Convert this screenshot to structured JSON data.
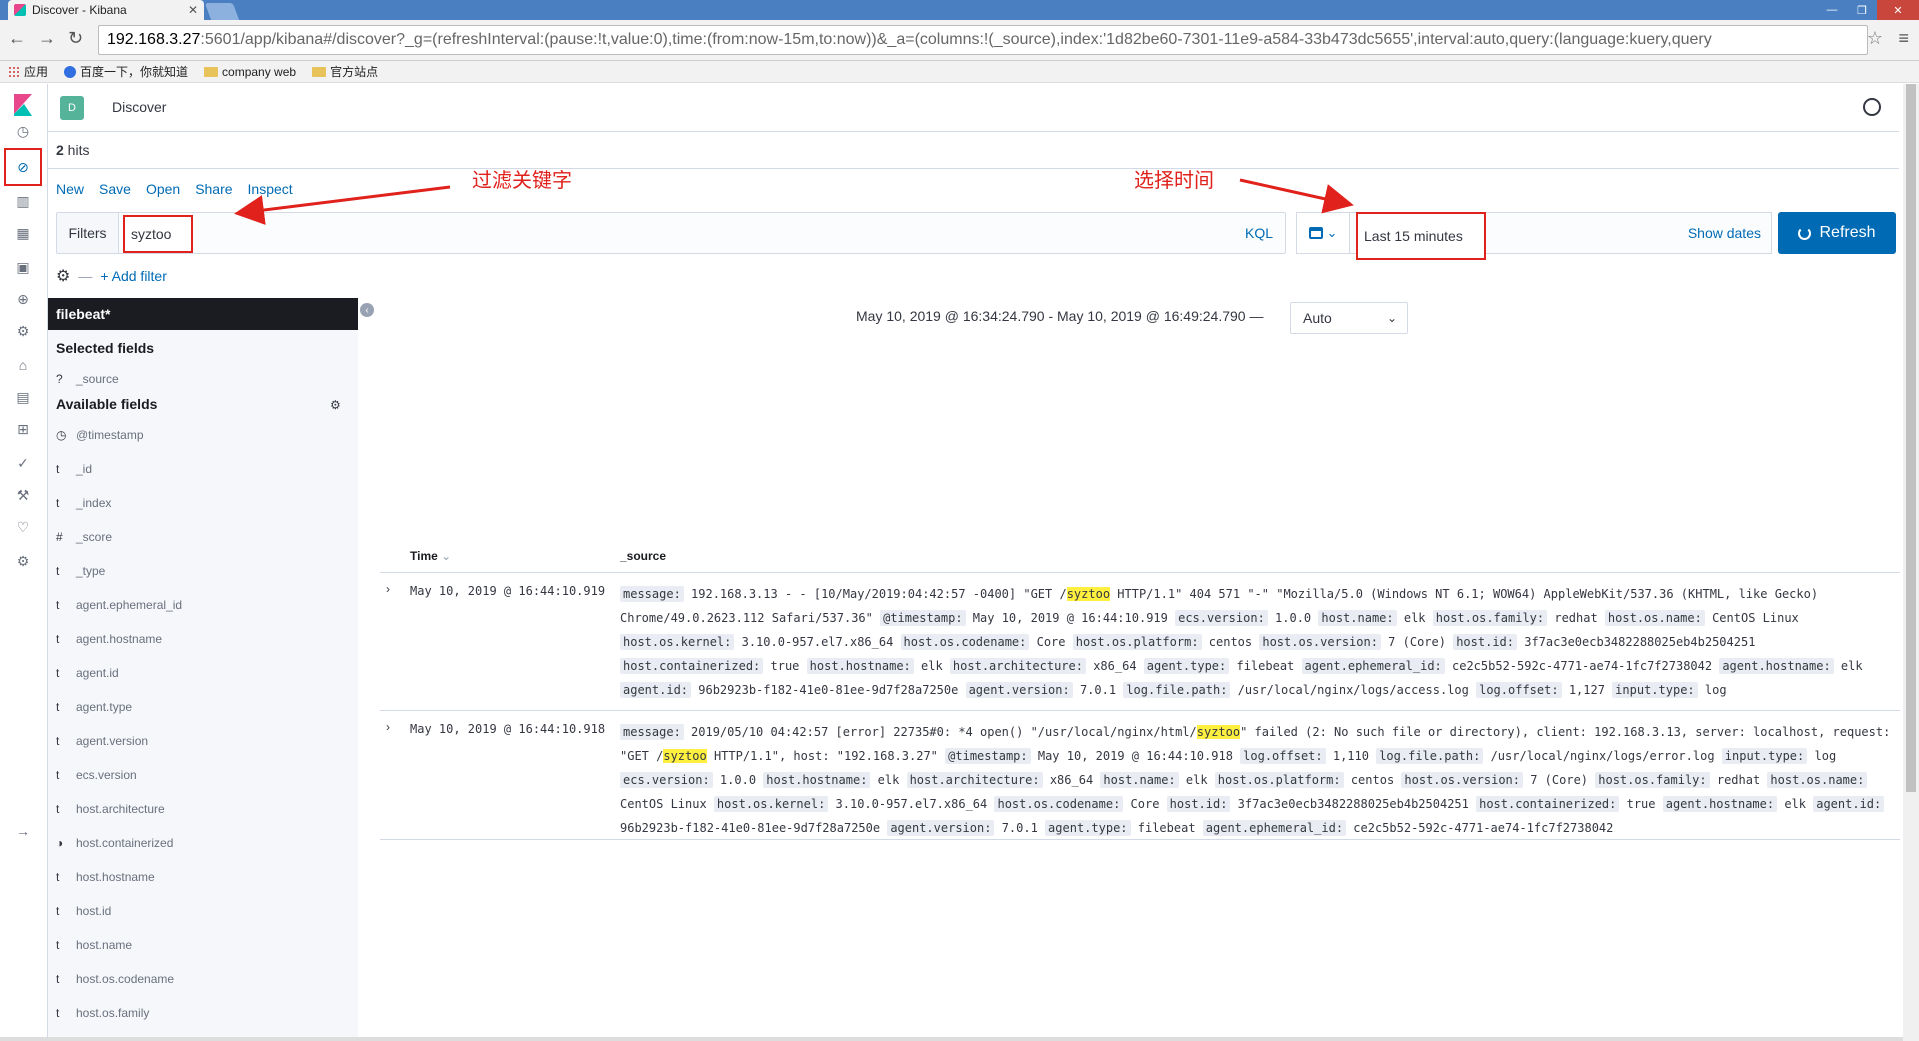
{
  "browser": {
    "tab_title": "Discover - Kibana",
    "url_host": "192.168.3.27",
    "url_rest": ":5601/app/kibana#/discover?_g=(refreshInterval:(pause:!t,value:0),time:(from:now-15m,to:now))&_a=(columns:!(_source),index:'1d82be60-7301-11e9-a584-33b473dc5655',interval:auto,query:(language:kuery,query",
    "bookmarks": [
      "应用",
      "百度一下，你就知道",
      "company web",
      "官方站点"
    ]
  },
  "header": {
    "space_initial": "D",
    "breadcrumb": "Discover"
  },
  "hits": {
    "count": "2",
    "label": " hits"
  },
  "topmenu": [
    "New",
    "Save",
    "Open",
    "Share",
    "Inspect"
  ],
  "query": {
    "filters_label": "Filters",
    "value": "syztoo",
    "language": "KQL"
  },
  "time": {
    "label": "Last 15 minutes",
    "show_dates": "Show dates",
    "refresh": "Refresh"
  },
  "add_filter": "+ Add filter",
  "index_pattern": "filebeat*",
  "selected_fields_title": "Selected fields",
  "selected_fields": [
    {
      "type": "?",
      "name": "_source"
    }
  ],
  "available_fields_title": "Available fields",
  "available_fields": [
    {
      "type": "◷",
      "name": "@timestamp"
    },
    {
      "type": "t",
      "name": "_id"
    },
    {
      "type": "t",
      "name": "_index"
    },
    {
      "type": "#",
      "name": "_score"
    },
    {
      "type": "t",
      "name": "_type"
    },
    {
      "type": "t",
      "name": "agent.ephemeral_id"
    },
    {
      "type": "t",
      "name": "agent.hostname"
    },
    {
      "type": "t",
      "name": "agent.id"
    },
    {
      "type": "t",
      "name": "agent.type"
    },
    {
      "type": "t",
      "name": "agent.version"
    },
    {
      "type": "t",
      "name": "ecs.version"
    },
    {
      "type": "t",
      "name": "host.architecture"
    },
    {
      "type": "◑",
      "name": "host.containerized"
    },
    {
      "type": "t",
      "name": "host.hostname"
    },
    {
      "type": "t",
      "name": "host.id"
    },
    {
      "type": "t",
      "name": "host.name"
    },
    {
      "type": "t",
      "name": "host.os.codename"
    },
    {
      "type": "t",
      "name": "host.os.family"
    }
  ],
  "range_text": "May 10, 2019 @ 16:34:24.790 - May 10, 2019 @ 16:49:24.790 —",
  "interval": "Auto",
  "table": {
    "col_time": "Time",
    "col_source": "_source"
  },
  "rows": [
    {
      "time": "May 10, 2019 @ 16:44:10.919",
      "source_html": "<span class='k'>message:</span> 192.168.3.13 - - [10/May/2019:04:42:57 -0400] \"GET /<span class='hl'>syztoo</span> HTTP/1.1\" 404 571 \"-\" \"Mozilla/5.0 (Windows NT 6.1; WOW64) AppleWebKit/537.36 (KHTML, like Gecko) Chrome/49.0.2623.112 Safari/537.36\" <span class='k'>@timestamp:</span> May 10, 2019 @ 16:44:10.919 <span class='k'>ecs.version:</span> 1.0.0 <span class='k'>host.name:</span> elk <span class='k'>host.os.family:</span> redhat <span class='k'>host.os.name:</span> CentOS Linux <span class='k'>host.os.kernel:</span> 3.10.0-957.el7.x86_64 <span class='k'>host.os.codename:</span> Core <span class='k'>host.os.platform:</span> centos <span class='k'>host.os.version:</span> 7 (Core) <span class='k'>host.id:</span> 3f7ac3e0ecb3482288025eb4b2504251 <span class='k'>host.containerized:</span> true <span class='k'>host.hostname:</span> elk <span class='k'>host.architecture:</span> x86_64 <span class='k'>agent.type:</span> filebeat <span class='k'>agent.ephemeral_id:</span> ce2c5b52-592c-4771-ae74-1fc7f2738042 <span class='k'>agent.hostname:</span> elk <span class='k'>agent.id:</span> 96b2923b-f182-41e0-81ee-9d7f28a7250e <span class='k'>agent.version:</span> 7.0.1 <span class='k'>log.file.path:</span> /usr/local/nginx/logs/access.log <span class='k'>log.offset:</span> 1,127 <span class='k'>input.type:</span> log"
    },
    {
      "time": "May 10, 2019 @ 16:44:10.918",
      "source_html": "<span class='k'>message:</span> 2019/05/10 04:42:57 [error] 22735#0: *4 open() \"/usr/local/nginx/html/<span class='hl'>syztoo</span>\" failed (2: No such file or directory), client: 192.168.3.13, server: localhost, request: \"GET /<span class='hl'>syztoo</span> HTTP/1.1\", host: \"192.168.3.27\" <span class='k'>@timestamp:</span> May 10, 2019 @ 16:44:10.918 <span class='k'>log.offset:</span> 1,110 <span class='k'>log.file.path:</span> /usr/local/nginx/logs/error.log <span class='k'>input.type:</span> log <span class='k'>ecs.version:</span> 1.0.0 <span class='k'>host.hostname:</span> elk <span class='k'>host.architecture:</span> x86_64 <span class='k'>host.name:</span> elk <span class='k'>host.os.platform:</span> centos <span class='k'>host.os.version:</span> 7 (Core) <span class='k'>host.os.family:</span> redhat <span class='k'>host.os.name:</span> CentOS Linux <span class='k'>host.os.kernel:</span> 3.10.0-957.el7.x86_64 <span class='k'>host.os.codename:</span> Core <span class='k'>host.id:</span> 3f7ac3e0ecb3482288025eb4b2504251 <span class='k'>host.containerized:</span> true <span class='k'>agent.hostname:</span> elk <span class='k'>agent.id:</span> 96b2923b-f182-41e0-81ee-9d7f28a7250e <span class='k'>agent.version:</span> 7.0.1 <span class='k'>agent.type:</span> filebeat <span class='k'>agent.ephemeral_id:</span> ce2c5b52-592c-4771-ae74-1fc7f2738042"
    }
  ],
  "annotations": {
    "filter": "过滤关键字",
    "time": "选择时间"
  },
  "colors": {
    "accent": "#006bb4",
    "annotation": "#e0211c",
    "highlight": "#fff03f"
  }
}
